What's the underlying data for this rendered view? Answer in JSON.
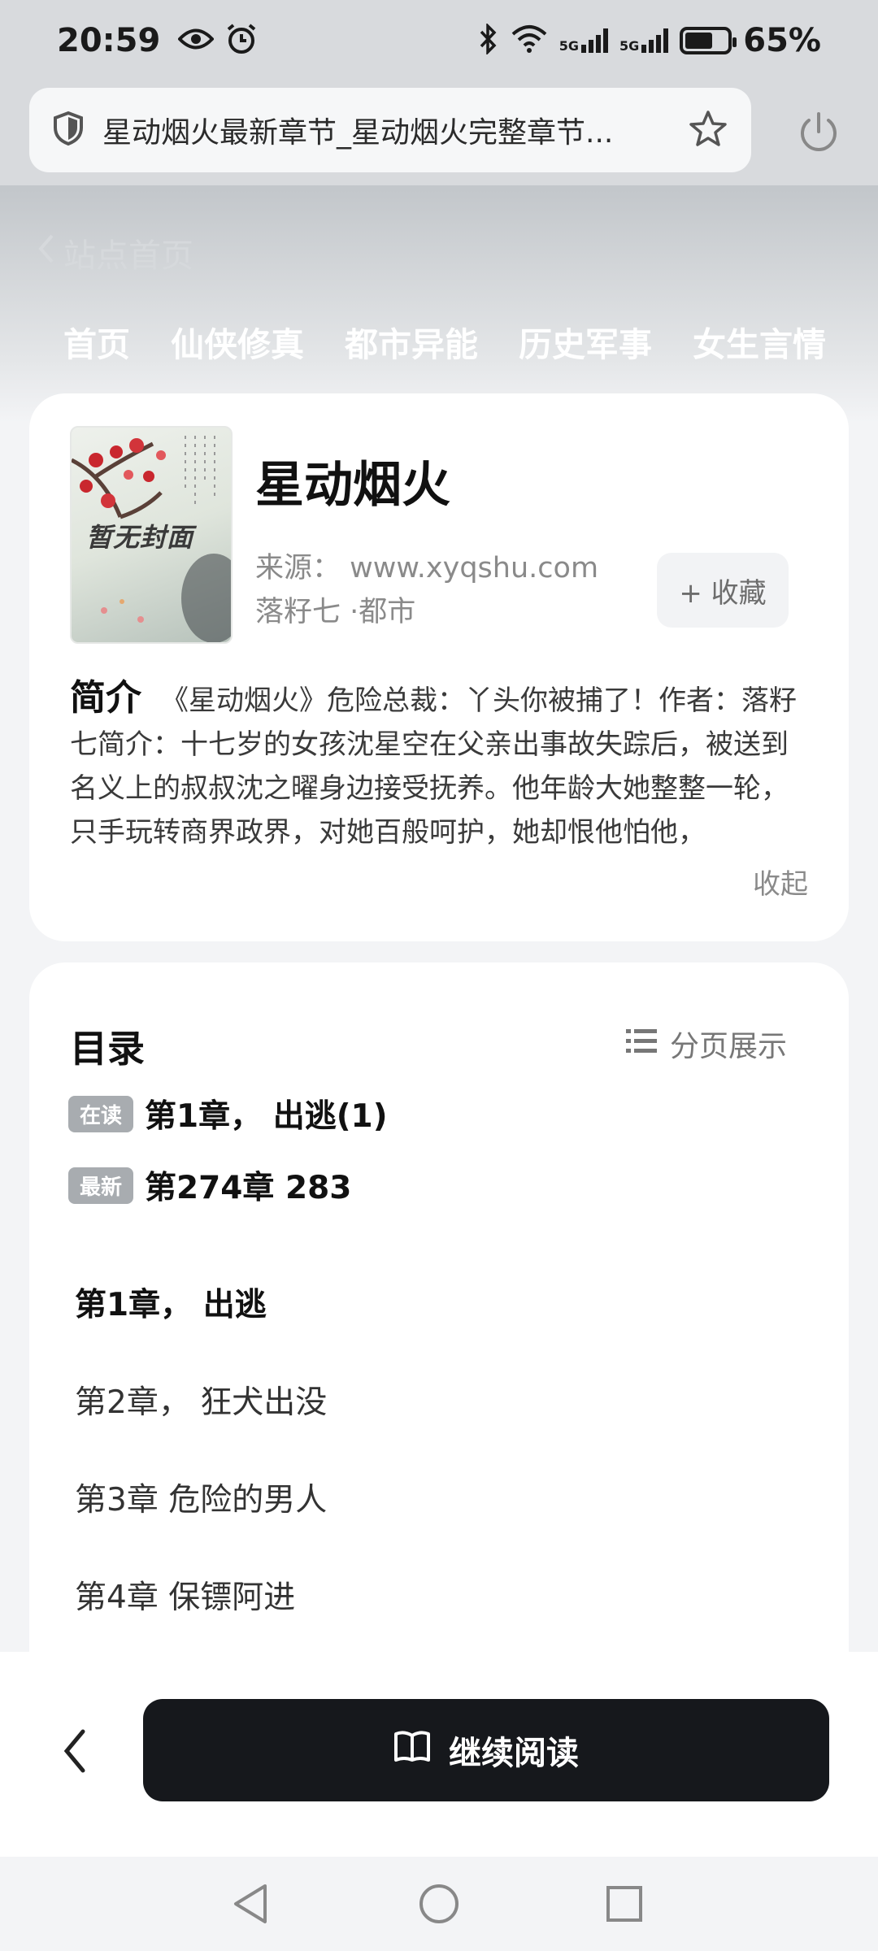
{
  "status_bar": {
    "time": "20:59",
    "battery_pct": "65%",
    "battery_level": 0.65,
    "signal1": "5G",
    "signal2": "5G"
  },
  "browser": {
    "url_text": "星动烟火最新章节_星动烟火完整章节..."
  },
  "back_link": "站点首页",
  "nav": [
    "首页",
    "仙侠修真",
    "都市异能",
    "历史军事",
    "女生言情"
  ],
  "book": {
    "cover_text": "暂无封面",
    "title": "星动烟火",
    "source": "来源： www.xyqshu.com",
    "author_genre": "落籽七 ·都市",
    "favorite_label": "+ 收藏",
    "intro_label": "简介",
    "intro_text": "《星动烟火》危险总裁：丫头你被捕了！作者：落籽七简介：十七岁的女孩沈星空在父亲出事故失踪后，被送到名义上的叔叔沈之曜身边接受抚养。他年龄大她整整一轮，只手玩转商界政界，对她百般呵护，她却恨他怕他，",
    "collapse_label": "收起"
  },
  "catalog": {
    "title": "目录",
    "pager_label": "分页展示",
    "reading_tag": "在读",
    "reading_chapter": "第1章， 出逃(1)",
    "latest_tag": "最新",
    "latest_chapter": "第274章 283",
    "chapters": [
      "第1章， 出逃",
      "第2章， 狂犬出没",
      "第3章 危险的男人",
      "第4章 保镖阿进"
    ]
  },
  "bottom": {
    "continue_label": "继续阅读"
  }
}
